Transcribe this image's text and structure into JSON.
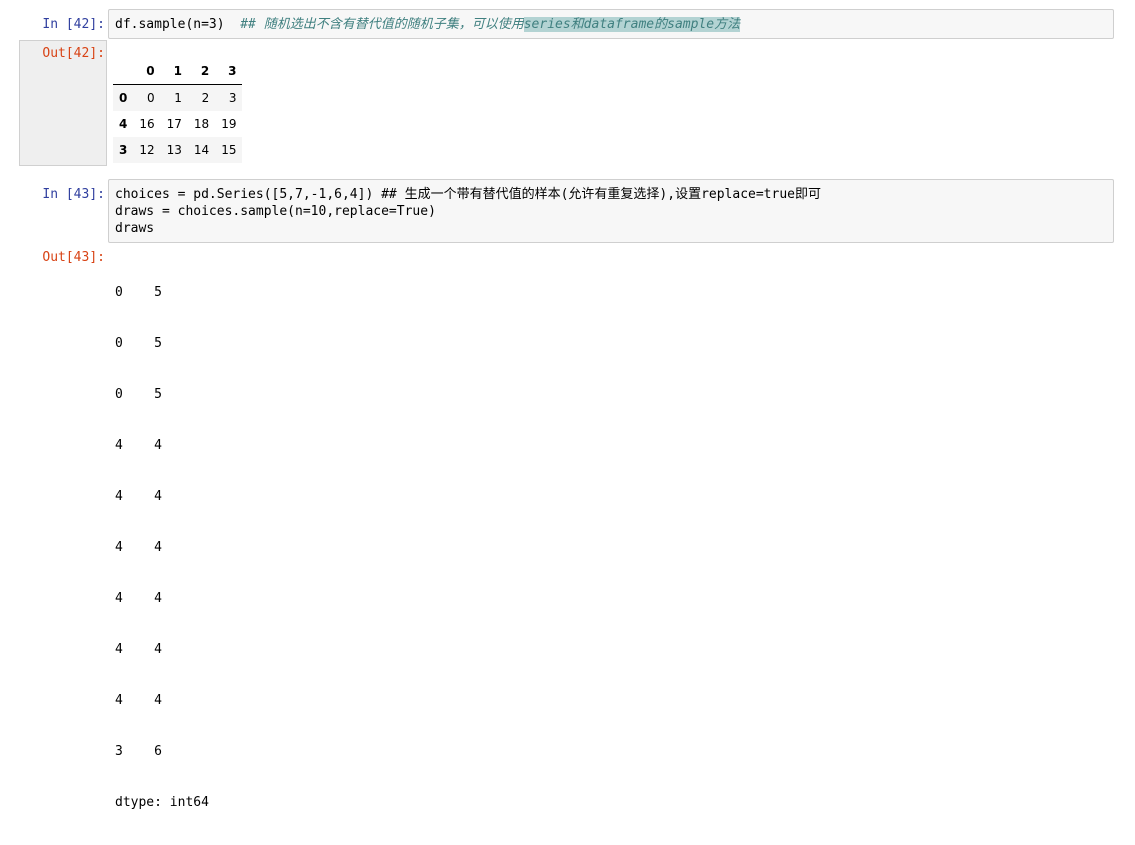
{
  "cells": [
    {
      "in_prompt": "In  [42]:",
      "out_prompt": "Out[42]:",
      "code": {
        "pre": "df.sample(n=3)  ",
        "comment_a": "## 随机选出不含有替代值的随机子集，可以使用",
        "comment_hl": "series和dataframe的sample方法"
      },
      "table": {
        "columns": [
          "",
          "0",
          "1",
          "2",
          "3"
        ],
        "rows": [
          {
            "index": "0",
            "values": [
              "0",
              "1",
              "2",
              "3"
            ]
          },
          {
            "index": "4",
            "values": [
              "16",
              "17",
              "18",
              "19"
            ]
          },
          {
            "index": "3",
            "values": [
              "12",
              "13",
              "14",
              "15"
            ]
          }
        ]
      }
    },
    {
      "in_prompt": "In  [43]:",
      "out_prompt": "Out[43]:",
      "code_lines": [
        "choices = pd.Series([5,7,-1,6,4]) ## 生成一个带有替代值的样本(允许有重复选择),设置replace=true即可",
        "draws = choices.sample(n=10,replace=True)",
        "draws"
      ],
      "output_lines": [
        "0    5",
        "0    5",
        "0    5",
        "4    4",
        "4    4",
        "4    4",
        "4    4",
        "4    4",
        "4    4",
        "3    6",
        "dtype: int64"
      ]
    }
  ]
}
